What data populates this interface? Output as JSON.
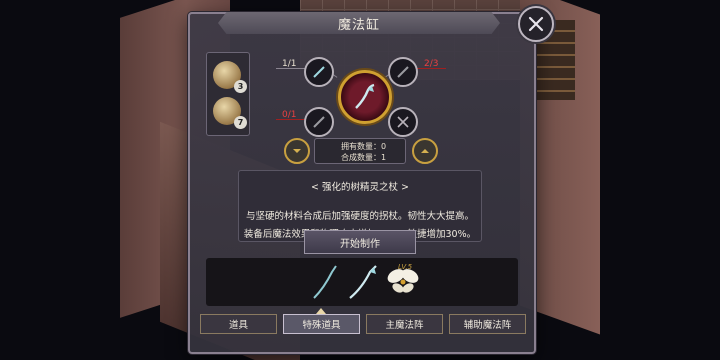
{
  "window": {
    "title": "魔法缸"
  },
  "ingredients": [
    {
      "icon": "cloth-bag-icon",
      "count": "3"
    },
    {
      "icon": "pouch-icon",
      "count": "7"
    }
  ],
  "craft": {
    "ratios": {
      "top_left": "1/1",
      "top_right": "2/3",
      "left": "0/1"
    },
    "info": {
      "owned": "拥有数量：0",
      "craftable": "合成数量：1"
    }
  },
  "item": {
    "name": "< 强化的树精灵之杖 >",
    "desc_line1": "与坚硬的材料合成后加强硬度的拐杖。韧性大大提高。",
    "desc_line2": "装备后魔法效果和物理攻击增加10%，敏捷增加30%。"
  },
  "start_button": "开始制作",
  "results": {
    "level": "LV.5"
  },
  "tabs": [
    "道具",
    "特殊道具",
    "主魔法阵",
    "辅助魔法阵"
  ],
  "active_tab": 1,
  "colors": {
    "accent_gold": "#c8a040",
    "warning_red": "#e84040"
  }
}
